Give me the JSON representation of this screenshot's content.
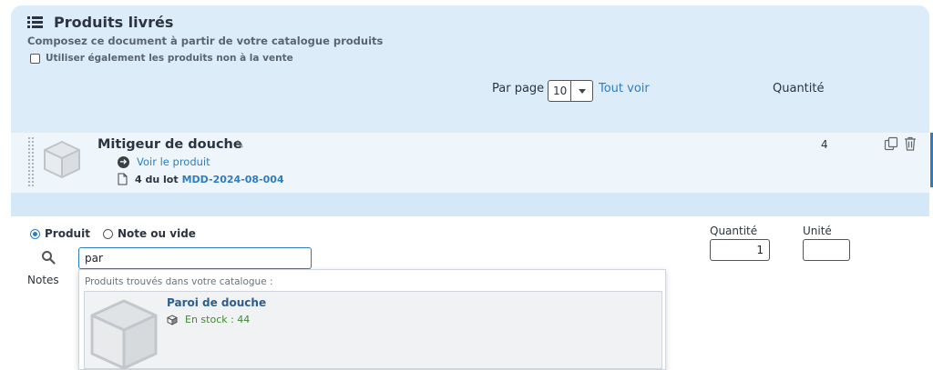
{
  "header": {
    "title": "Produits livrés",
    "subtitle": "Composez ce document à partir de votre catalogue produits",
    "non_sale_checkbox_label": "Utiliser également les produits non à la vente",
    "non_sale_checked": false
  },
  "pagination": {
    "per_page_label": "Par page",
    "per_page_value": "10",
    "show_all_link": "Tout voir"
  },
  "columns": {
    "quantity": "Quantité"
  },
  "item": {
    "name": "Mitigeur de douche",
    "view_link": "Voir le produit",
    "lot_prefix": "4 du lot",
    "lot_code": "MDD-2024-08-004",
    "quantity": "4"
  },
  "form": {
    "type_product_label": "Produit",
    "type_note_label": "Note ou vide",
    "selected_type": "Produit",
    "search_value": "par",
    "notes_label": "Notes",
    "quantity_label": "Quantité",
    "quantity_value": "1",
    "unit_label": "Unité",
    "unit_value": ""
  },
  "suggestions": {
    "header": "Produits trouvés dans votre catalogue :",
    "results": [
      {
        "name": "Paroi de douche",
        "stock": "En stock : 44"
      }
    ]
  },
  "colors": {
    "panel_bg": "#dcecf9",
    "accent": "#2f7cc0",
    "stock_green": "#3d8b2f"
  }
}
